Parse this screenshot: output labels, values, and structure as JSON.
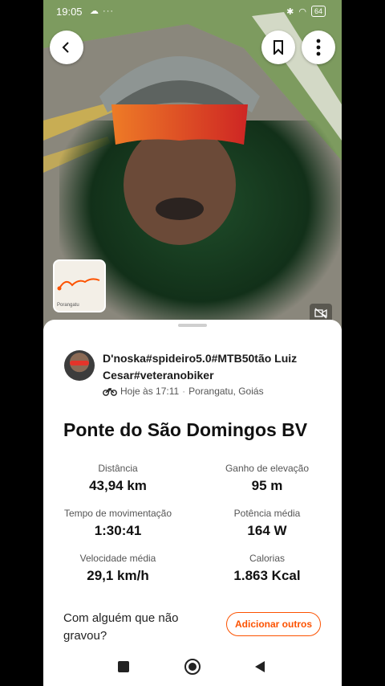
{
  "status": {
    "time": "19:05",
    "left_icons": "☁ ···",
    "battery": "64"
  },
  "photo": {
    "map_label": "Porangatu"
  },
  "activity": {
    "athlete_name": "D'noska#spideiro5.0#MTB50tão Luiz Cesar#veteranobiker",
    "time_text": "Hoje às 17:11",
    "separator": "·",
    "location": "Porangatu, Goiás",
    "title": "Ponte do São Domingos BV"
  },
  "stats": [
    {
      "label": "Distância",
      "value": "43,94 km"
    },
    {
      "label": "Ganho de elevação",
      "value": "95 m"
    },
    {
      "label": "Tempo de movimentação",
      "value": "1:30:41"
    },
    {
      "label": "Potência média",
      "value": "164 W"
    },
    {
      "label": "Velocidade média",
      "value": "29,1 km/h"
    },
    {
      "label": "Calorias",
      "value": "1.863 Kcal"
    }
  ],
  "cta": {
    "question": "Com alguém que não gravou?",
    "button_label": "Adicionar outros"
  },
  "colors": {
    "accent": "#fc5200"
  },
  "icons": [
    "back-icon",
    "bookmark-icon",
    "more-vertical-icon",
    "bike-icon",
    "mute-icon",
    "square-nav-icon",
    "home-nav-icon",
    "back-nav-icon"
  ]
}
